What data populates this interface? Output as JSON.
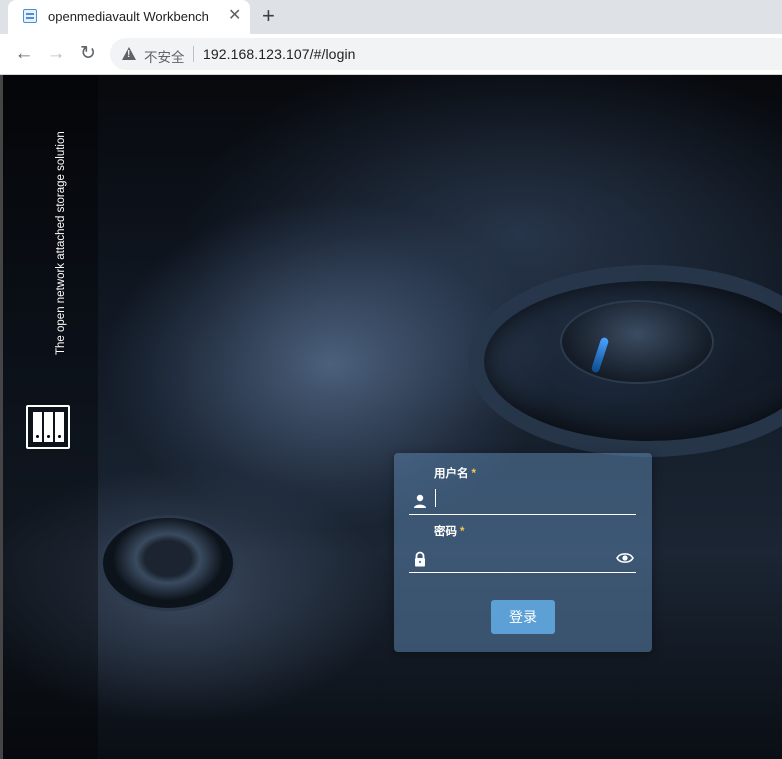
{
  "browser": {
    "tab": {
      "title": "openmediavault Workbench",
      "close": "✕"
    },
    "new_tab": "+",
    "nav": {
      "back": "←",
      "forward": "→",
      "reload": "↻"
    },
    "address": {
      "security_label": "不安全",
      "url": "192.168.123.107/#/login"
    }
  },
  "brand": {
    "name": "openmediavault",
    "tagline": "The open network attached storage solution"
  },
  "login": {
    "username": {
      "label": "用户名",
      "required": "*",
      "value": ""
    },
    "password": {
      "label": "密码",
      "required": "*",
      "value": ""
    },
    "submit_label": "登录"
  },
  "colors": {
    "card": "#5a82aa",
    "button": "#5ca0d6",
    "required_star": "#f2c94c"
  }
}
